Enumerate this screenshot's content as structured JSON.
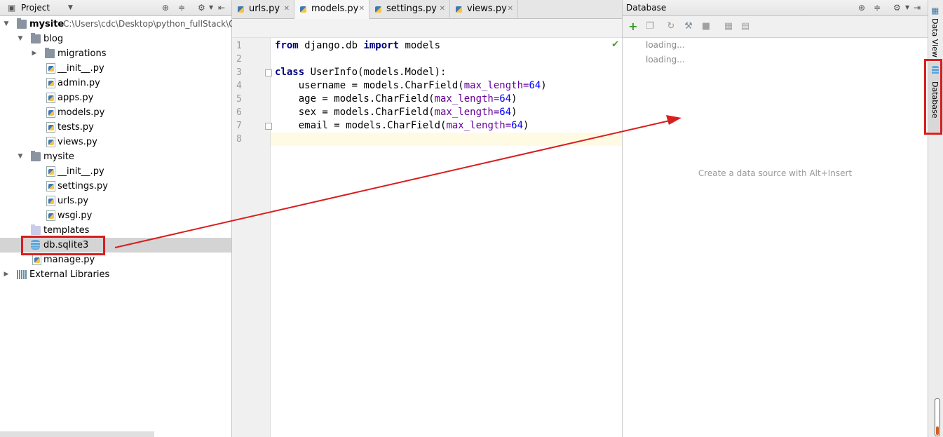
{
  "project": {
    "title": "Project",
    "tree": [
      {
        "label": "mysite",
        "path": "C:\\Users\\cdc\\Desktop\\python_fullStack\\0"
      },
      {
        "label": "blog"
      },
      {
        "label": "migrations"
      },
      {
        "label": "__init__.py"
      },
      {
        "label": "admin.py"
      },
      {
        "label": "apps.py"
      },
      {
        "label": "models.py"
      },
      {
        "label": "tests.py"
      },
      {
        "label": "views.py"
      },
      {
        "label": "mysite"
      },
      {
        "label": "__init__.py"
      },
      {
        "label": "settings.py"
      },
      {
        "label": "urls.py"
      },
      {
        "label": "wsgi.py"
      },
      {
        "label": "templates"
      },
      {
        "label": "db.sqlite3"
      },
      {
        "label": "manage.py"
      },
      {
        "label": "External Libraries"
      }
    ]
  },
  "editor": {
    "tabs": [
      {
        "label": "urls.py"
      },
      {
        "label": "models.py"
      },
      {
        "label": "settings.py"
      },
      {
        "label": "views.py"
      }
    ],
    "line_numbers": [
      "1",
      "2",
      "3",
      "4",
      "5",
      "6",
      "7",
      "8"
    ],
    "code": {
      "l1_kw1": "from",
      "l1_mid": " django.db ",
      "l1_kw2": "import",
      "l1_end": " models",
      "l3_kw": "class",
      "l3_rest": " UserInfo(models.Model):",
      "l4_a": "    username = models.CharField(",
      "l4_p": "max_length=",
      "l4_n": "64",
      "l4_e": ")",
      "l5_a": "    age = models.CharField(",
      "l5_p": "max_length=",
      "l5_n": "64",
      "l5_e": ")",
      "l6_a": "    sex = models.CharField(",
      "l6_p": "max_length=",
      "l6_n": "64",
      "l6_e": ")",
      "l7_a": "    email = models.CharField(",
      "l7_p": "max_length=",
      "l7_n": "64",
      "l7_e": ")"
    }
  },
  "database": {
    "title": "Database",
    "loading": [
      "loading...",
      "loading..."
    ],
    "empty_hint": "Create a data source with Alt+Insert"
  },
  "right_strip": {
    "data_view": "Data View",
    "database": "Database"
  },
  "colors": {
    "annotation": "#d81e1e",
    "keyword": "#000080",
    "param": "#660099",
    "number": "#0000ff"
  }
}
